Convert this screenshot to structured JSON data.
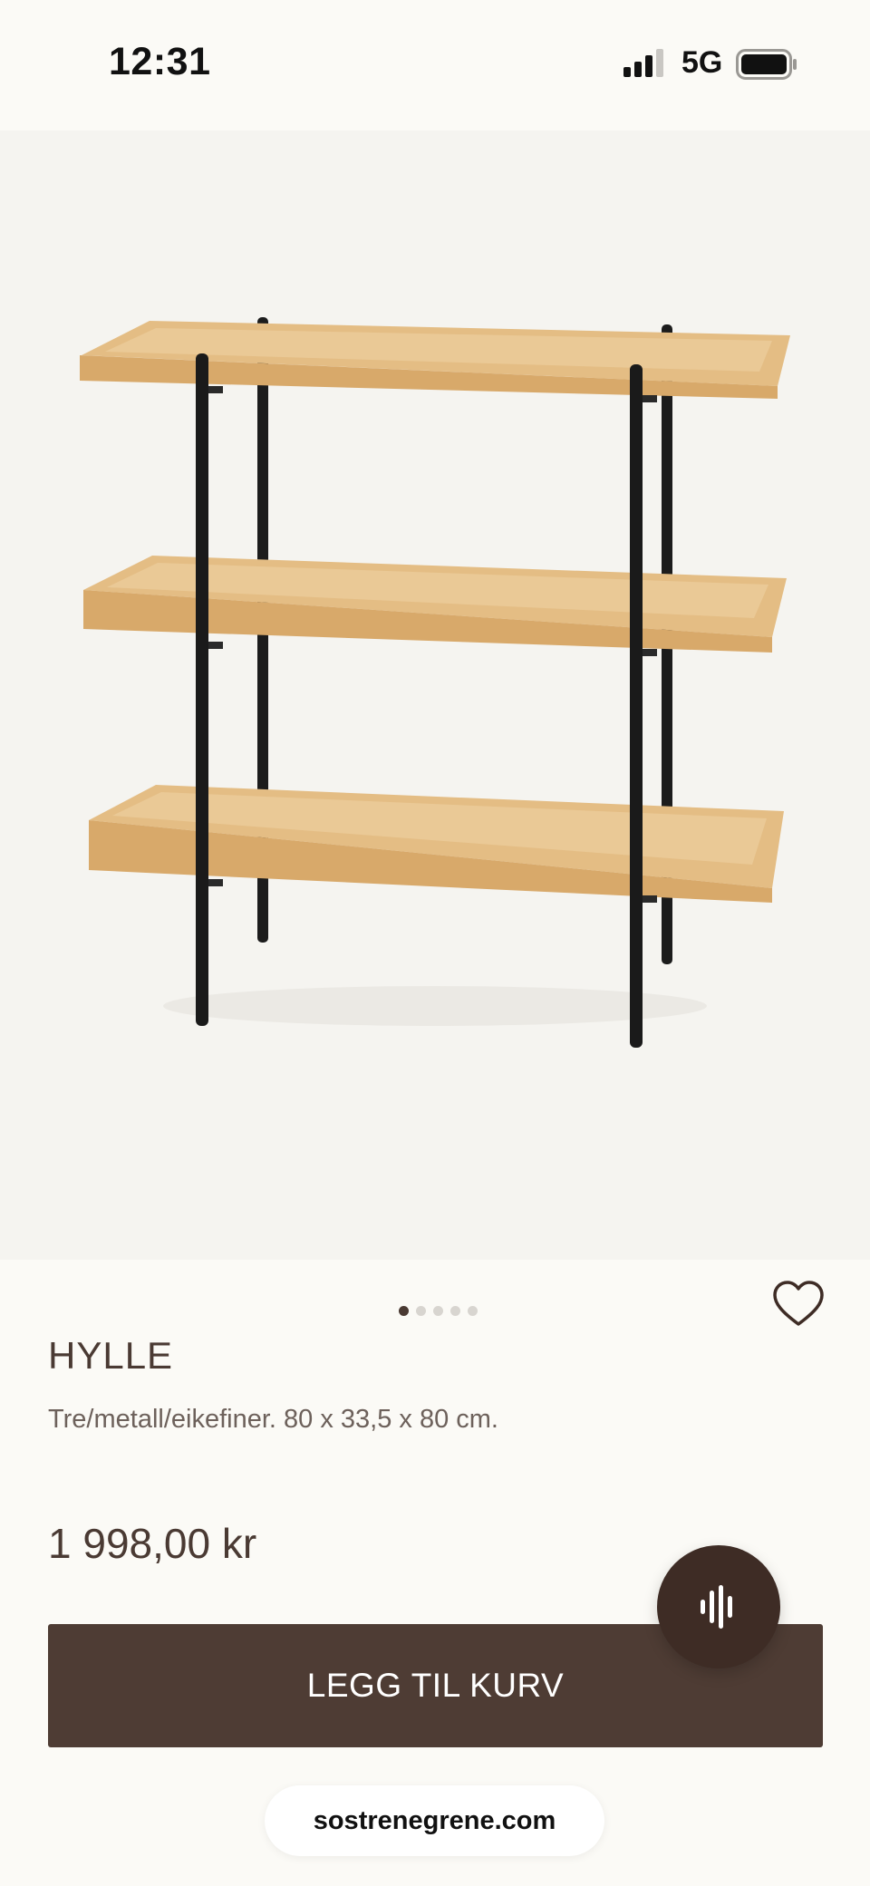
{
  "status_bar": {
    "time": "12:31",
    "network": "5G",
    "icons": [
      "signal-icon",
      "battery-icon"
    ]
  },
  "product": {
    "image": "shelf-image",
    "gallery_count": 5,
    "gallery_active_index": 0,
    "title": "HYLLE",
    "description": "Tre/metall/eikefiner. 80 x 33,5 x 80 cm.",
    "price": "1 998,00 kr",
    "favorite_icon": "heart-outline-icon"
  },
  "actions": {
    "add_to_cart_label": "LEGG TIL KURV",
    "voice_icon": "voice-waveform-icon"
  },
  "browser": {
    "url": "sostrenegrene.com"
  },
  "colors": {
    "background": "#fbfaf6",
    "image_background": "#f5f4f0",
    "primary_text": "#4a3a33",
    "button": "#4e3c34",
    "voice_button": "#3e2c25",
    "wood": "#e6c089"
  }
}
